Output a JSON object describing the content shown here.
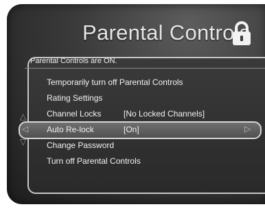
{
  "header": {
    "title": "Parental Controls",
    "lock_icon": "padlock-icon"
  },
  "status": {
    "text": "Parental Controls are ON."
  },
  "menu": {
    "items": [
      {
        "label": "Temporarily turn off Parental Controls",
        "value": ""
      },
      {
        "label": "Rating Settings",
        "value": ""
      },
      {
        "label": "Channel Locks",
        "value": "[No Locked Channels]"
      },
      {
        "label": "Auto Re-lock",
        "value": "[On]"
      },
      {
        "label": "Change Password",
        "value": ""
      },
      {
        "label": "Turn off Parental Controls",
        "value": ""
      }
    ],
    "selected_index": 3
  },
  "colors": {
    "highlight": "#5e5e5e",
    "panel_border": "#c8c8c8",
    "text": "#f2f2f2"
  }
}
